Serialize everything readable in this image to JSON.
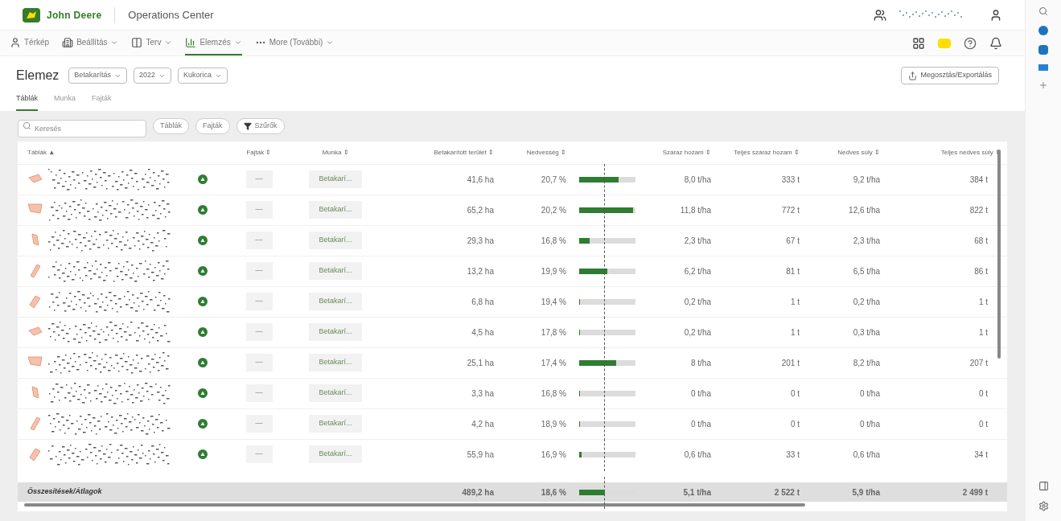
{
  "header": {
    "brand": "John Deere",
    "app_title": "Operations Center"
  },
  "nav": [
    {
      "label": "Térkép",
      "kind": "person",
      "dropdown": false,
      "selected": false
    },
    {
      "label": "Beállítás",
      "kind": "building",
      "dropdown": true,
      "selected": false
    },
    {
      "label": "Terv",
      "kind": "columns",
      "dropdown": true,
      "selected": false
    },
    {
      "label": "Elemzés",
      "kind": "chart",
      "dropdown": true,
      "selected": true
    },
    {
      "label": "More (További)",
      "kind": "dots",
      "dropdown": true,
      "selected": false
    }
  ],
  "page_title": "Elemez",
  "filters": [
    "Betakarítás",
    "2022",
    "Kukorica"
  ],
  "export_button": "Megosztás/Exportálás",
  "tabs": [
    {
      "label": "Táblák",
      "selected": true
    },
    {
      "label": "Munka",
      "selected": false
    },
    {
      "label": "Fajták",
      "selected": false
    }
  ],
  "search": {
    "placeholder": "Keresés"
  },
  "chips": [
    {
      "label": "Táblák",
      "kind": "plain"
    },
    {
      "label": "Fajták",
      "kind": "plain"
    },
    {
      "label": "Szűrők",
      "kind": "filter"
    }
  ],
  "table": {
    "columns": [
      "Táblák ▲",
      "Fajták ⇕",
      "Munka ⇕",
      "Betakarított terület ⇕",
      "Nedvesség ⇕",
      "Száraz hozam ⇕",
      "Teljes száraz hozam ⇕",
      "Nedves súly ⇕",
      "Teljes nedves súly ⇕"
    ],
    "rows": [
      {
        "variety": "—",
        "job": "Betakarí...",
        "area": "41,6 ha",
        "moisture": "20,7 %",
        "level": 0.7,
        "dry_yield": "8,0 t/ha",
        "total_dry": "333 t",
        "wet_yield": "9,2 t/ha",
        "total_wet": "384 t"
      },
      {
        "variety": "—",
        "job": "Betakarí...",
        "area": "65,2 ha",
        "moisture": "20,2 %",
        "level": 0.95,
        "dry_yield": "11,8 t/ha",
        "total_dry": "772 t",
        "wet_yield": "12,6 t/ha",
        "total_wet": "822 t"
      },
      {
        "variety": "—",
        "job": "Betakarí...",
        "area": "29,3 ha",
        "moisture": "16,8 %",
        "level": 0.18,
        "dry_yield": "2,3 t/ha",
        "total_dry": "67 t",
        "wet_yield": "2,3 t/ha",
        "total_wet": "68 t"
      },
      {
        "variety": "—",
        "job": "Betakarí...",
        "area": "13,2 ha",
        "moisture": "19,9 %",
        "level": 0.5,
        "dry_yield": "6,2 t/ha",
        "total_dry": "81 t",
        "wet_yield": "6,5 t/ha",
        "total_wet": "86 t"
      },
      {
        "variety": "—",
        "job": "Betakarí...",
        "area": "6,8 ha",
        "moisture": "19,4 %",
        "level": 0.02,
        "dry_yield": "0,2 t/ha",
        "total_dry": "1 t",
        "wet_yield": "0,2 t/ha",
        "total_wet": "1 t"
      },
      {
        "variety": "—",
        "job": "Betakarí...",
        "area": "4,5 ha",
        "moisture": "17,8 %",
        "level": 0.02,
        "dry_yield": "0,2 t/ha",
        "total_dry": "1 t",
        "wet_yield": "0,3 t/ha",
        "total_wet": "1 t"
      },
      {
        "variety": "—",
        "job": "Betakarí...",
        "area": "25,1 ha",
        "moisture": "17,4 %",
        "level": 0.65,
        "dry_yield": "8 t/ha",
        "total_dry": "201 t",
        "wet_yield": "8,2 t/ha",
        "total_wet": "207 t"
      },
      {
        "variety": "—",
        "job": "Betakarí...",
        "area": "3,3 ha",
        "moisture": "16,8 %",
        "level": 0,
        "dry_yield": "0 t/ha",
        "total_dry": "0 t",
        "wet_yield": "0 t/ha",
        "total_wet": "0 t"
      },
      {
        "variety": "—",
        "job": "Betakarí...",
        "area": "4,2 ha",
        "moisture": "18,9 %",
        "level": 0,
        "dry_yield": "0 t/ha",
        "total_dry": "0 t",
        "wet_yield": "0 t/ha",
        "total_wet": "0 t"
      },
      {
        "variety": "—",
        "job": "Betakarí...",
        "area": "55,9 ha",
        "moisture": "16,9 %",
        "level": 0.04,
        "dry_yield": "0,6 t/ha",
        "total_dry": "33 t",
        "wet_yield": "0,6 t/ha",
        "total_wet": "34 t"
      }
    ],
    "totals": {
      "label": "Összesítések/Átlagok",
      "area": "489,2 ha",
      "moisture": "18,6 %",
      "level": 0.45,
      "dry_yield": "5,1 t/ha",
      "total_dry": "2 522 t",
      "wet_yield": "5,9 t/ha",
      "total_wet": "2 499 t"
    }
  }
}
